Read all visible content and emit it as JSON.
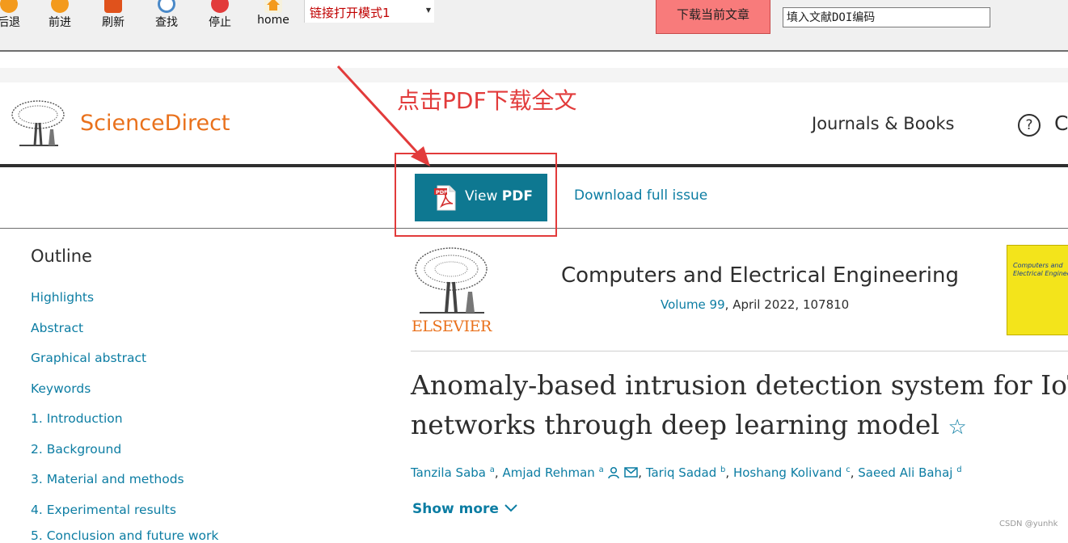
{
  "toolbar": {
    "buttons": [
      {
        "label": "后退",
        "icon": "back-icon",
        "color": "#f39a1d"
      },
      {
        "label": "前进",
        "icon": "forward-icon",
        "color": "#f39a1d"
      },
      {
        "label": "刷新",
        "icon": "refresh-icon",
        "color": "#e0521c"
      },
      {
        "label": "查找",
        "icon": "find-icon",
        "color": "#4a89c8"
      },
      {
        "label": "停止",
        "icon": "stop-icon",
        "color": "#e23b3b"
      },
      {
        "label": "home",
        "icon": "home-icon",
        "color": "#f39a1d"
      }
    ],
    "mode_select": "链接打开模式1",
    "download_button": "下载当前文章",
    "doi_placeholder": "填入文献DOI编码"
  },
  "annotation": {
    "text": "点击PDF下载全文",
    "color": "#e23b3b"
  },
  "header": {
    "brand": "ScienceDirect",
    "journals_books": "Journals & Books",
    "help_icon": "question-icon",
    "partial_text": "C"
  },
  "pdf_bar": {
    "view_pdf_prefix": "View ",
    "view_pdf_bold": "PDF",
    "download_issue": "Download full issue"
  },
  "outline": {
    "title": "Outline",
    "items": [
      "Highlights",
      "Abstract",
      "Graphical abstract",
      "Keywords",
      "1. Introduction",
      "2. Background",
      "3. Material and methods",
      "4. Experimental results",
      "5. Conclusion and future work"
    ]
  },
  "article": {
    "publisher": "ELSEVIER",
    "journal": "Computers and Electrical Engineering",
    "volume_link": "Volume 99",
    "volume_rest": ", April 2022, 107810",
    "cover_text_1": "Computers and",
    "cover_text_2": "Electrical Engineering",
    "title_line1": "Anomaly-based intrusion detection system for IoT",
    "title_line2": "networks through deep learning model",
    "authors": [
      {
        "name": "Tanzila Saba",
        "sup": "a"
      },
      {
        "name": "Amjad Rehman",
        "sup": "a"
      },
      {
        "name": "Tariq Sadad",
        "sup": "b"
      },
      {
        "name": "Hoshang Kolivand",
        "sup": "c"
      },
      {
        "name": "Saeed Ali Bahaj",
        "sup": "d"
      }
    ],
    "show_more": "Show more"
  },
  "watermark": "CSDN @yunhk",
  "colors": {
    "link": "#0c7da3",
    "brand": "#e9711c",
    "pdf_button": "#0e7891",
    "download_button": "#f87b7b"
  }
}
